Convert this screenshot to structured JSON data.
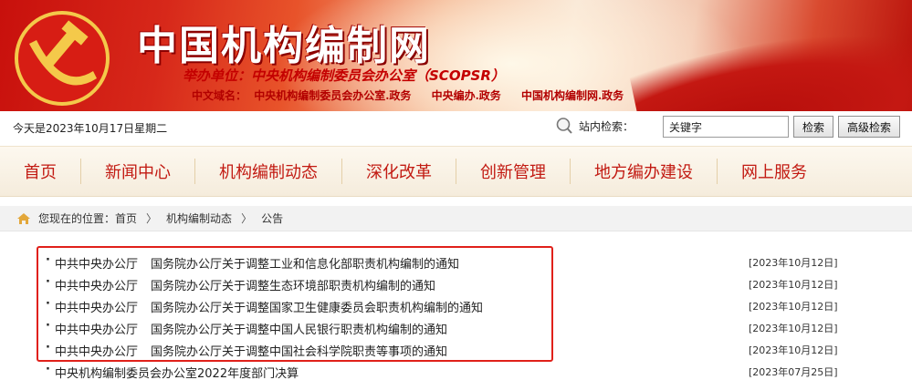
{
  "header": {
    "site_title": "中国机构编制网",
    "sponsor": "举办单位：中央机构编制委员会办公室（SCOPSR）",
    "domains_label": "中文域名：",
    "domains": [
      "中央机构编制委员会办公室.政务",
      "中央编办.政务",
      "中国机构编制网.政务"
    ]
  },
  "infobar": {
    "date": "今天是2023年10月17日星期二",
    "search_label": "站内检索：",
    "search_value": "关键字",
    "search_button": "检索",
    "advanced_button": "高级检索"
  },
  "nav": {
    "items": [
      "首页",
      "新闻中心",
      "机构编制动态",
      "深化改革",
      "创新管理",
      "地方编办建设",
      "网上服务"
    ]
  },
  "breadcrumb": {
    "prefix": "您现在的位置：",
    "items": [
      "首页",
      "机构编制动态",
      "公告"
    ]
  },
  "list": {
    "items": [
      {
        "org": "中共中央办公厅",
        "title": "国务院办公厅关于调整工业和信息化部职责机构编制的通知",
        "date": "[2023年10月12日]"
      },
      {
        "org": "中共中央办公厅",
        "title": "国务院办公厅关于调整生态环境部职责机构编制的通知",
        "date": "[2023年10月12日]"
      },
      {
        "org": "中共中央办公厅",
        "title": "国务院办公厅关于调整国家卫生健康委员会职责机构编制的通知",
        "date": "[2023年10月12日]"
      },
      {
        "org": "中共中央办公厅",
        "title": "国务院办公厅关于调整中国人民银行职责机构编制的通知",
        "date": "[2023年10月12日]"
      },
      {
        "org": "中共中央办公厅",
        "title": "国务院办公厅关于调整中国社会科学院职责等事项的通知",
        "date": "[2023年10月12日]"
      },
      {
        "org": "",
        "title": "中央机构编制委员会办公室2022年度部门决算",
        "date": "[2023年07月25日]"
      }
    ]
  },
  "colors": {
    "brand_red": "#c21a12",
    "highlight": "#e0201a"
  },
  "icons": {
    "emblem": "party-emblem-icon",
    "search": "magnifier-icon",
    "home": "home-icon"
  }
}
